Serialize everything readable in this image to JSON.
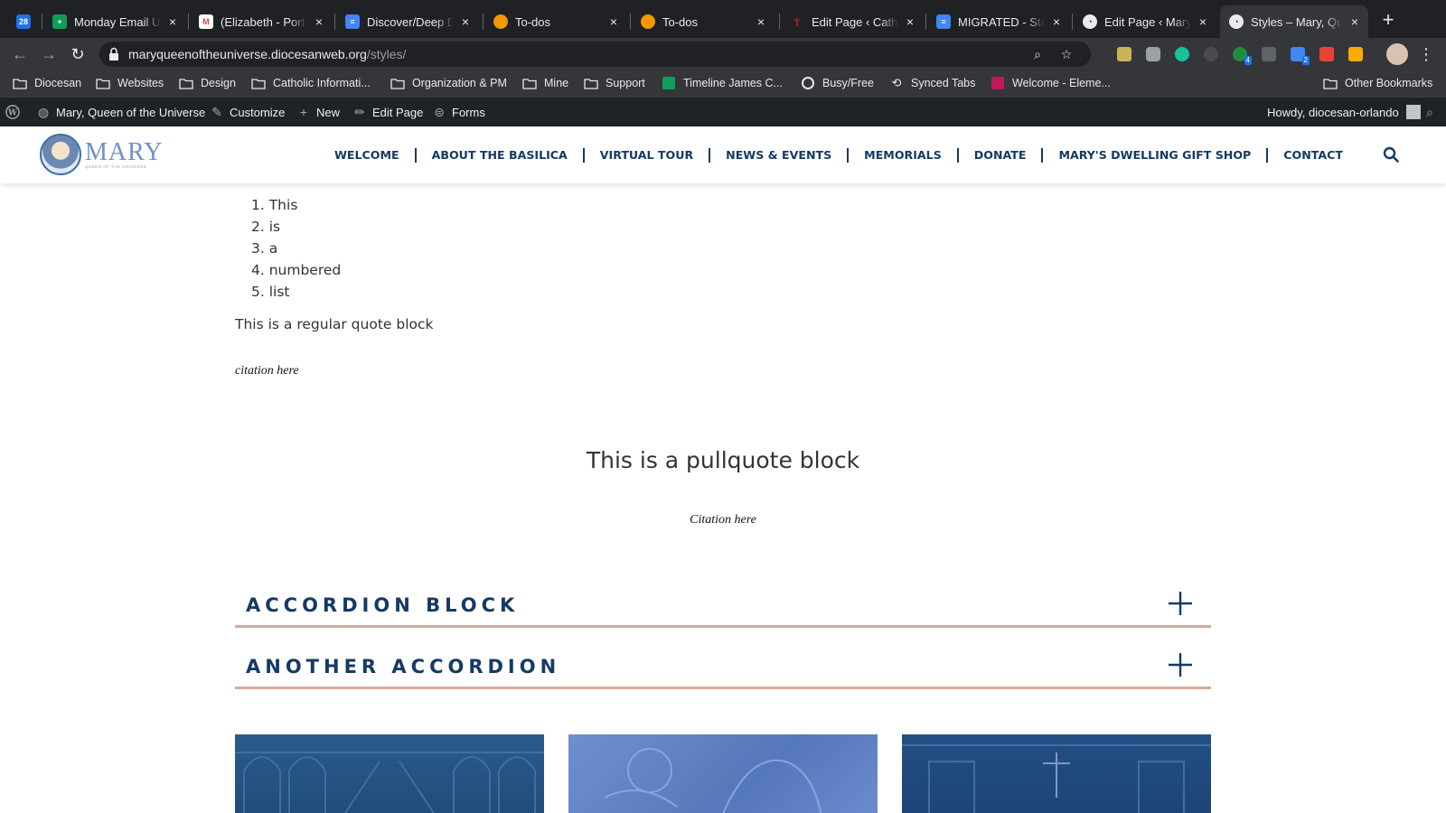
{
  "tabs": [
    {
      "title": "",
      "favicon": "calendar-icon",
      "favicon_text": "28",
      "color": "#1a73e8"
    },
    {
      "title": "Monday Email Up",
      "favicon": "sheets-icon",
      "color": "#0f9d58"
    },
    {
      "title": "(Elizabeth - Port",
      "favicon": "gmail-icon",
      "color": "#ea4335"
    },
    {
      "title": "Discover/Deep Di",
      "favicon": "docs-icon",
      "color": "#4285f4"
    },
    {
      "title": "To-dos",
      "favicon": "todo-icon",
      "color": "#f29900"
    },
    {
      "title": "To-dos",
      "favicon": "todo-icon",
      "color": "#f29900"
    },
    {
      "title": "Edit Page ‹ Cathe",
      "favicon": "cross-icon",
      "color": "#8b1a1a"
    },
    {
      "title": "MIGRATED - Staf",
      "favicon": "docs-icon",
      "color": "#4285f4"
    },
    {
      "title": "Edit Page ‹ Mary,",
      "favicon": "site-icon",
      "color": "#9aa0a6"
    },
    {
      "title": "Styles – Mary, Qu",
      "favicon": "site-icon",
      "color": "#9aa0a6"
    }
  ],
  "address_bar": {
    "host": "maryqueenoftheuniverse.diocesanweb.org",
    "path": "/styles/"
  },
  "bookmarks": [
    {
      "label": "Diocesan",
      "icon": "folder-icon"
    },
    {
      "label": "Websites",
      "icon": "folder-icon"
    },
    {
      "label": "Design",
      "icon": "folder-icon"
    },
    {
      "label": "Catholic Informati...",
      "icon": "folder-icon"
    },
    {
      "label": "Organization & PM",
      "icon": "folder-icon"
    },
    {
      "label": "Mine",
      "icon": "folder-icon"
    },
    {
      "label": "Support",
      "icon": "folder-icon"
    },
    {
      "label": "Timeline James C...",
      "icon": "sheets-icon"
    },
    {
      "label": "Busy/Free",
      "icon": "globe-icon"
    },
    {
      "label": "Synced Tabs",
      "icon": "history-icon"
    },
    {
      "label": "Welcome - Eleme...",
      "icon": "elementor-icon"
    },
    {
      "label": "Other Bookmarks",
      "icon": "folder-icon"
    }
  ],
  "admin_bar": {
    "site_name": "Mary, Queen of the Universe",
    "customize": "Customize",
    "new": "New",
    "edit_page": "Edit Page",
    "forms": "Forms",
    "howdy": "Howdy, diocesan-orlando"
  },
  "site": {
    "logo_text": "MARY",
    "logo_sub": "QUEEN OF THE UNIVERSE",
    "nav": [
      "WELCOME",
      "ABOUT THE BASILICA",
      "VIRTUAL TOUR",
      "NEWS & EVENTS",
      "MEMORIALS",
      "DONATE",
      "MARY'S DWELLING GIFT SHOP",
      "CONTACT"
    ]
  },
  "content": {
    "numbered_list": [
      "This",
      "is",
      "a",
      "numbered",
      "list"
    ],
    "quote": "This is a regular quote block",
    "quote_citation": "citation here",
    "pullquote": "This is a pullquote block",
    "pullquote_citation": "Citation here",
    "accordions": [
      "ACCORDION BLOCK",
      "ANOTHER ACCORDION"
    ]
  },
  "colors": {
    "brand_navy": "#153a63",
    "accordion_rule": "#d9a995"
  }
}
